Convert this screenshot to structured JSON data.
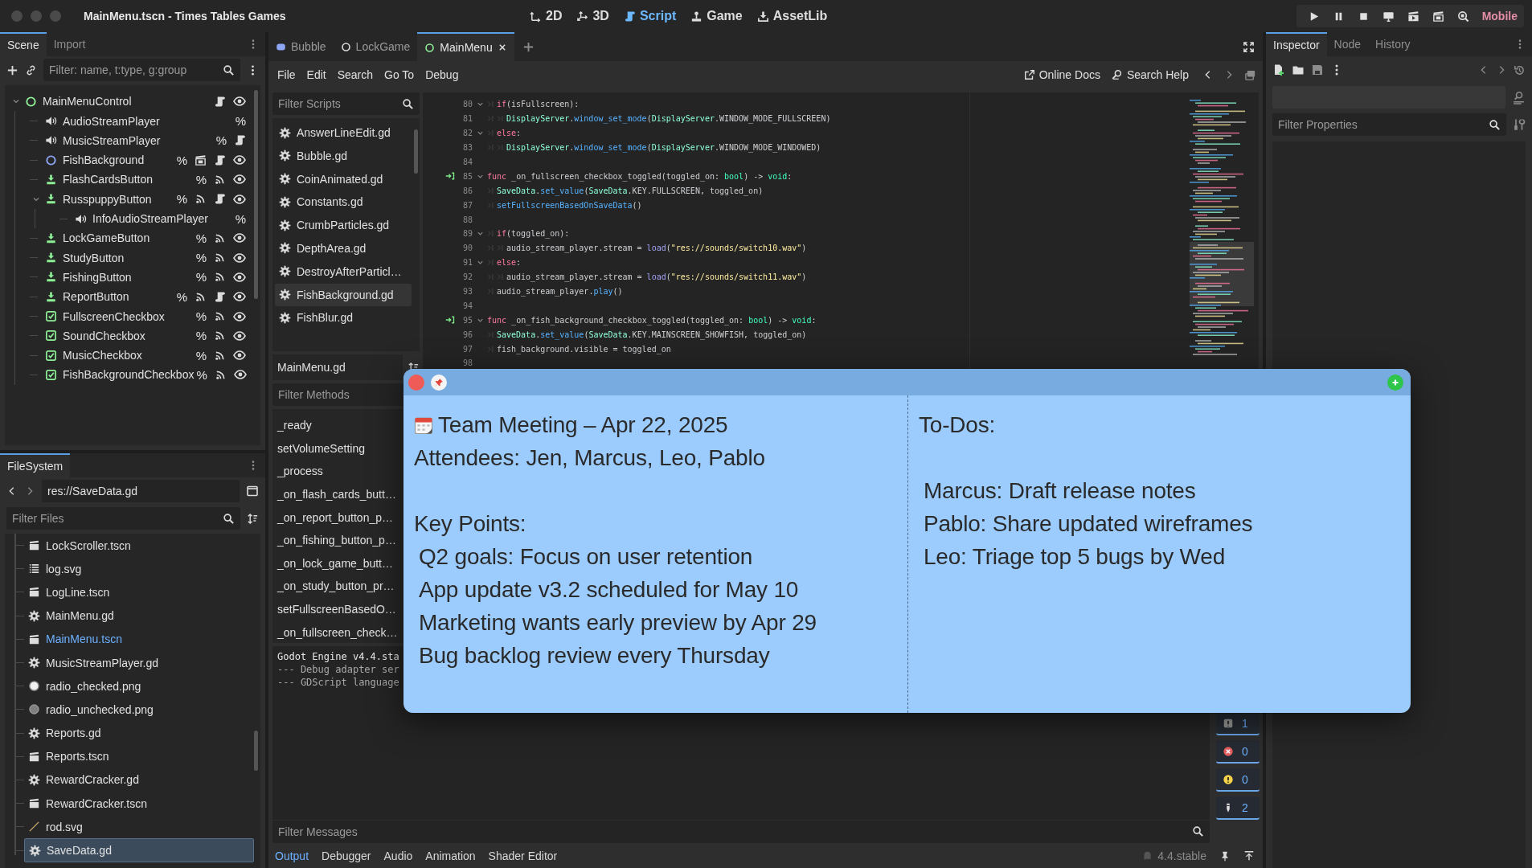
{
  "window": {
    "title": "MainMenu.tscn - Times Tables Games"
  },
  "main_screens": [
    {
      "label": "2D",
      "kind": "flat",
      "selected": false
    },
    {
      "label": "3D",
      "kind": "spatial",
      "selected": false
    },
    {
      "label": "Script",
      "kind": "script",
      "selected": true
    },
    {
      "label": "Game",
      "kind": "game",
      "selected": false
    },
    {
      "label": "AssetLib",
      "kind": "assetlib",
      "selected": false
    }
  ],
  "renderer": "Mobile",
  "scene_dock": {
    "tabs": [
      {
        "label": "Scene",
        "selected": true
      },
      {
        "label": "Import",
        "selected": false
      }
    ],
    "filter": {
      "placeholder": "Filter: name, t:type, g:group"
    },
    "tree": [
      {
        "name": "MainMenuControl",
        "kind": "control",
        "expanded": true,
        "scene": false,
        "signals": false,
        "script": true,
        "visibility": true,
        "children": [
          {
            "name": "AudioStreamPlayer",
            "kind": "audio",
            "unique": "%",
            "scene": false,
            "signals": false,
            "script": false,
            "visibility": false
          },
          {
            "name": "MusicStreamPlayer",
            "kind": "audio",
            "unique": "%",
            "scene": false,
            "signals": false,
            "script": true,
            "visibility": false
          },
          {
            "name": "FishBackground",
            "kind": "node2d",
            "unique": "%",
            "scene": true,
            "signals": false,
            "script": true,
            "visibility": true
          },
          {
            "name": "FlashCardsButton",
            "kind": "button",
            "unique": "%",
            "scene": false,
            "signals": true,
            "script": false,
            "visibility": true
          },
          {
            "name": "RusspuppyButton",
            "kind": "button",
            "unique": "%",
            "expanded": true,
            "scene": false,
            "signals": true,
            "script": true,
            "visibility": true,
            "children": [
              {
                "name": "InfoAudioStreamPlayer",
                "kind": "audio",
                "unique": "%",
                "scene": false,
                "signals": false,
                "script": false,
                "visibility": false
              }
            ]
          },
          {
            "name": "LockGameButton",
            "kind": "button",
            "unique": "%",
            "scene": false,
            "signals": true,
            "script": false,
            "visibility": true
          },
          {
            "name": "StudyButton",
            "kind": "button",
            "unique": "%",
            "scene": false,
            "signals": true,
            "script": false,
            "visibility": true
          },
          {
            "name": "FishingButton",
            "kind": "button",
            "unique": "%",
            "scene": false,
            "signals": true,
            "script": false,
            "visibility": true
          },
          {
            "name": "ReportButton",
            "kind": "button",
            "unique": "%",
            "scene": false,
            "signals": true,
            "script": true,
            "visibility": true
          },
          {
            "name": "FullscreenCheckbox",
            "kind": "checkbox",
            "unique": "%",
            "scene": false,
            "signals": true,
            "script": false,
            "visibility": true
          },
          {
            "name": "SoundCheckbox",
            "kind": "checkbox",
            "unique": "%",
            "scene": false,
            "signals": true,
            "script": false,
            "visibility": true
          },
          {
            "name": "MusicCheckbox",
            "kind": "checkbox",
            "unique": "%",
            "scene": false,
            "signals": true,
            "script": false,
            "visibility": true
          },
          {
            "name": "FishBackgroundCheckbox",
            "kind": "checkbox",
            "unique": "%",
            "scene": false,
            "signals": true,
            "script": false,
            "visibility": true
          }
        ]
      }
    ]
  },
  "filesystem": {
    "tab": "FileSystem",
    "path": "res://SaveData.gd",
    "filter": {
      "placeholder": "Filter Files"
    },
    "files": [
      {
        "name": "LockScroller.tscn",
        "kind": "scene",
        "open": false,
        "selected": false
      },
      {
        "name": "log.svg",
        "kind": "list_image",
        "open": false,
        "selected": false
      },
      {
        "name": "LogLine.tscn",
        "kind": "scene",
        "open": false,
        "selected": false
      },
      {
        "name": "MainMenu.gd",
        "kind": "script",
        "open": false,
        "selected": false
      },
      {
        "name": "MainMenu.tscn",
        "kind": "scene",
        "open": true,
        "selected": false
      },
      {
        "name": "MusicStreamPlayer.gd",
        "kind": "script",
        "open": false,
        "selected": false
      },
      {
        "name": "radio_checked.png",
        "kind": "radio_on",
        "open": false,
        "selected": false
      },
      {
        "name": "radio_unchecked.png",
        "kind": "radio_off",
        "open": false,
        "selected": false
      },
      {
        "name": "Reports.gd",
        "kind": "script",
        "open": false,
        "selected": false
      },
      {
        "name": "Reports.tscn",
        "kind": "scene",
        "open": false,
        "selected": false
      },
      {
        "name": "RewardCracker.gd",
        "kind": "script",
        "open": false,
        "selected": false
      },
      {
        "name": "RewardCracker.tscn",
        "kind": "scene",
        "open": false,
        "selected": false
      },
      {
        "name": "rod.svg",
        "kind": "rod_image",
        "open": false,
        "selected": false
      },
      {
        "name": "SaveData.gd",
        "kind": "script",
        "open": false,
        "selected": true
      }
    ]
  },
  "editor_tabs": [
    {
      "label": "Bubble",
      "kind": "bubble",
      "selected": false
    },
    {
      "label": "LockGame",
      "kind": "ring",
      "selected": false
    },
    {
      "label": "MainMenu",
      "kind": "ring",
      "selected": true
    }
  ],
  "script_menu": [
    "File",
    "Edit",
    "Search",
    "Go To",
    "Debug"
  ],
  "help_links": [
    {
      "label": "Online Docs",
      "kind": "docs"
    },
    {
      "label": "Search Help",
      "kind": "help"
    }
  ],
  "scripts_panel": {
    "filter": {
      "placeholder": "Filter Scripts"
    },
    "scripts": [
      {
        "name": "AnswerLineEdit.gd",
        "selected": false
      },
      {
        "name": "Bubble.gd",
        "selected": false
      },
      {
        "name": "CoinAnimated.gd",
        "selected": false
      },
      {
        "name": "Constants.gd",
        "selected": false
      },
      {
        "name": "CrumbParticles.gd",
        "selected": false
      },
      {
        "name": "DepthArea.gd",
        "selected": false
      },
      {
        "name": "DestroyAfterParticl…",
        "selected": false
      },
      {
        "name": "FishBackground.gd",
        "selected": true
      },
      {
        "name": "FishBlur.gd",
        "selected": false
      }
    ],
    "current": "MainMenu.gd",
    "methods_filter": {
      "placeholder": "Filter Methods"
    },
    "methods": [
      "_ready",
      "setVolumeSetting",
      "_process",
      "_on_flash_cards_butt…",
      "_on_report_button_p…",
      "_on_fishing_button_p…",
      "_on_lock_game_butt…",
      "_on_study_button_pr…",
      "setFullscreenBasedO…",
      "_on_fullscreen_check…"
    ]
  },
  "code_lines": [
    {
      "number": "80",
      "fold": true,
      "connected": false,
      "tokens": [
        {
          "kind": "tab"
        },
        {
          "kind": "keyword",
          "text": "if"
        },
        {
          "kind": "plain",
          "text": "(isFullscreen):"
        }
      ]
    },
    {
      "number": "81",
      "fold": false,
      "connected": false,
      "tokens": [
        {
          "kind": "tab"
        },
        {
          "kind": "tab"
        },
        {
          "kind": "class",
          "text": "DisplayServer"
        },
        {
          "kind": "plain",
          "text": "."
        },
        {
          "kind": "method",
          "text": "window_set_mode"
        },
        {
          "kind": "plain",
          "text": "("
        },
        {
          "kind": "class",
          "text": "DisplayServer"
        },
        {
          "kind": "plain",
          "text": ".WINDOW_MODE_FULLSCREEN)"
        }
      ]
    },
    {
      "number": "82",
      "fold": true,
      "connected": false,
      "tokens": [
        {
          "kind": "tab"
        },
        {
          "kind": "keyword",
          "text": "else"
        },
        {
          "kind": "plain",
          "text": ":"
        }
      ]
    },
    {
      "number": "83",
      "fold": false,
      "connected": false,
      "tokens": [
        {
          "kind": "tab"
        },
        {
          "kind": "tab"
        },
        {
          "kind": "class",
          "text": "DisplayServer"
        },
        {
          "kind": "plain",
          "text": "."
        },
        {
          "kind": "method",
          "text": "window_set_mode"
        },
        {
          "kind": "plain",
          "text": "("
        },
        {
          "kind": "class",
          "text": "DisplayServer"
        },
        {
          "kind": "plain",
          "text": ".WINDOW_MODE_WINDOWED)"
        }
      ]
    },
    {
      "number": "84",
      "fold": false,
      "connected": false
    },
    {
      "number": "85",
      "fold": true,
      "connected": true,
      "tokens": [
        {
          "kind": "keyword",
          "text": "func"
        },
        {
          "kind": "plain",
          "text": " _on_fullscreen_checkbox_toggled(toggled_on: "
        },
        {
          "kind": "type",
          "text": "bool"
        },
        {
          "kind": "plain",
          "text": ") -> "
        },
        {
          "kind": "type",
          "text": "void"
        },
        {
          "kind": "plain",
          "text": ":"
        }
      ]
    },
    {
      "number": "86",
      "fold": false,
      "connected": false,
      "tokens": [
        {
          "kind": "tab"
        },
        {
          "kind": "class",
          "text": "SaveData"
        },
        {
          "kind": "plain",
          "text": "."
        },
        {
          "kind": "method",
          "text": "set_value"
        },
        {
          "kind": "plain",
          "text": "("
        },
        {
          "kind": "class",
          "text": "SaveData"
        },
        {
          "kind": "plain",
          "text": ".KEY.FULLSCREEN, toggled_on)"
        }
      ]
    },
    {
      "number": "87",
      "fold": false,
      "connected": false,
      "tokens": [
        {
          "kind": "tab"
        },
        {
          "kind": "method",
          "text": "setFullscreenBasedOnSaveData"
        },
        {
          "kind": "plain",
          "text": "()"
        }
      ]
    },
    {
      "number": "88",
      "fold": false,
      "connected": false
    },
    {
      "number": "89",
      "fold": true,
      "connected": false,
      "tokens": [
        {
          "kind": "tab"
        },
        {
          "kind": "keyword",
          "text": "if"
        },
        {
          "kind": "plain",
          "text": "(toggled_on):"
        }
      ]
    },
    {
      "number": "90",
      "fold": false,
      "connected": false,
      "tokens": [
        {
          "kind": "tab"
        },
        {
          "kind": "tab"
        },
        {
          "kind": "plain",
          "text": "audio_stream_player.stream = "
        },
        {
          "kind": "builtin",
          "text": "load"
        },
        {
          "kind": "plain",
          "text": "("
        },
        {
          "kind": "string",
          "text": "\"res://sounds/switch10.wav\""
        },
        {
          "kind": "plain",
          "text": ")"
        }
      ]
    },
    {
      "number": "91",
      "fold": true,
      "connected": false,
      "tokens": [
        {
          "kind": "tab"
        },
        {
          "kind": "keyword",
          "text": "else"
        },
        {
          "kind": "plain",
          "text": ":"
        }
      ]
    },
    {
      "number": "92",
      "fold": false,
      "connected": false,
      "tokens": [
        {
          "kind": "tab"
        },
        {
          "kind": "tab"
        },
        {
          "kind": "plain",
          "text": "audio_stream_player.stream = "
        },
        {
          "kind": "builtin",
          "text": "load"
        },
        {
          "kind": "plain",
          "text": "("
        },
        {
          "kind": "string",
          "text": "\"res://sounds/switch11.wav\""
        },
        {
          "kind": "plain",
          "text": ")"
        }
      ]
    },
    {
      "number": "93",
      "fold": false,
      "connected": false,
      "tokens": [
        {
          "kind": "tab"
        },
        {
          "kind": "plain",
          "text": "audio_stream_player."
        },
        {
          "kind": "method",
          "text": "play"
        },
        {
          "kind": "plain",
          "text": "()"
        }
      ]
    },
    {
      "number": "94",
      "fold": false,
      "connected": false
    },
    {
      "number": "95",
      "fold": true,
      "connected": true,
      "tokens": [
        {
          "kind": "keyword",
          "text": "func"
        },
        {
          "kind": "plain",
          "text": " _on_fish_background_checkbox_toggled(toggled_on: "
        },
        {
          "kind": "type",
          "text": "bool"
        },
        {
          "kind": "plain",
          "text": ") -> "
        },
        {
          "kind": "type",
          "text": "void"
        },
        {
          "kind": "plain",
          "text": ":"
        }
      ]
    },
    {
      "number": "96",
      "fold": false,
      "connected": false,
      "tokens": [
        {
          "kind": "tab"
        },
        {
          "kind": "class",
          "text": "SaveData"
        },
        {
          "kind": "plain",
          "text": "."
        },
        {
          "kind": "method",
          "text": "set_value"
        },
        {
          "kind": "plain",
          "text": "("
        },
        {
          "kind": "class",
          "text": "SaveData"
        },
        {
          "kind": "plain",
          "text": ".KEY.MAINSCREEN_SHOWFISH, toggled_on)"
        }
      ]
    },
    {
      "number": "97",
      "fold": false,
      "connected": false,
      "tokens": [
        {
          "kind": "tab"
        },
        {
          "kind": "plain",
          "text": "fish_background.visible = toggled_on"
        }
      ]
    },
    {
      "number": "98",
      "fold": false,
      "connected": false
    }
  ],
  "console": {
    "lines": [
      {
        "kind": "header",
        "text": "Godot Engine v4.4.sta"
      },
      {
        "kind": "note",
        "text": "--- Debug adapter ser"
      },
      {
        "kind": "note",
        "text": "--- GDScript language"
      }
    ],
    "filter": {
      "placeholder": "Filter Messages"
    },
    "counters": [
      {
        "kind": "message",
        "count": "1"
      },
      {
        "kind": "error",
        "count": "0"
      },
      {
        "kind": "warning",
        "count": "0"
      },
      {
        "kind": "info",
        "count": "2"
      }
    ]
  },
  "bottom_tabs": [
    {
      "label": "Output",
      "selected": true
    },
    {
      "label": "Debugger",
      "selected": false
    },
    {
      "label": "Audio",
      "selected": false
    },
    {
      "label": "Animation",
      "selected": false
    },
    {
      "label": "Shader Editor",
      "selected": false
    }
  ],
  "version": "4.4.stable",
  "inspector": {
    "tabs": [
      {
        "label": "Inspector",
        "selected": true
      },
      {
        "label": "Node",
        "selected": false
      },
      {
        "label": "History",
        "selected": false
      }
    ],
    "filter": {
      "placeholder": "Filter Properties"
    }
  },
  "sticky_note": {
    "columns": [
      [
        {
          "kind": "title",
          "text": "Team Meeting – Apr 22, 2025"
        },
        {
          "kind": "line",
          "text": "Attendees: Jen, Marcus, Leo, Pablo"
        },
        {
          "kind": "blank"
        },
        {
          "kind": "line",
          "text": "Key Points:"
        },
        {
          "kind": "item",
          "text": "Q2 goals: Focus on user retention"
        },
        {
          "kind": "item",
          "text": "App update v3.2 scheduled for May 10"
        },
        {
          "kind": "item",
          "text": "Marketing wants early preview by Apr 29"
        },
        {
          "kind": "item",
          "text": "Bug backlog review every Thursday"
        }
      ],
      [
        {
          "kind": "line",
          "text": "To-Dos:"
        },
        {
          "kind": "blank"
        },
        {
          "kind": "item",
          "text": "Marcus: Draft release notes"
        },
        {
          "kind": "item",
          "text": "Pablo: Share updated wireframes"
        },
        {
          "kind": "item",
          "text": "Leo: Triage top 5 bugs by Wed"
        }
      ]
    ]
  }
}
